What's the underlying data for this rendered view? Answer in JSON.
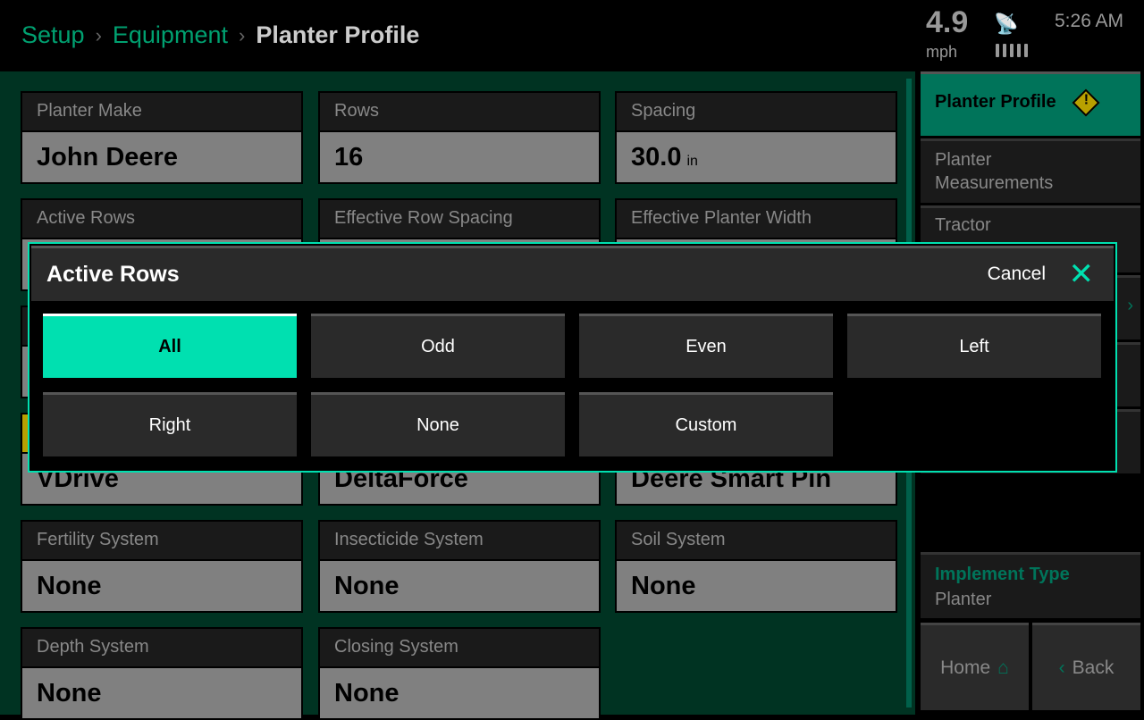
{
  "breadcrumb": [
    "Setup",
    "Equipment",
    "Planter Profile"
  ],
  "status": {
    "speed": "4.9",
    "speed_unit": "mph",
    "time": "5:26 AM",
    "gps_icon": "satellite-icon",
    "signal_bars": 5
  },
  "cards": [
    {
      "label": "Planter Make",
      "value": "John Deere"
    },
    {
      "label": "Rows",
      "value": "16"
    },
    {
      "label": "Spacing",
      "value": "30.0",
      "unit": "in"
    },
    {
      "label": "Active Rows",
      "value": ""
    },
    {
      "label": "Effective Row Spacing",
      "value": ""
    },
    {
      "label": "Effective Planter Width",
      "value": ""
    },
    {
      "label": "",
      "value": "VDrive"
    },
    {
      "label": "",
      "value": "DeltaForce"
    },
    {
      "label": "",
      "value": "Deere Smart Pin"
    },
    {
      "label": "Fertility System",
      "value": "None"
    },
    {
      "label": "Insecticide System",
      "value": "None"
    },
    {
      "label": "Soil System",
      "value": "None"
    },
    {
      "label": "Depth System",
      "value": "None"
    },
    {
      "label": "Closing System",
      "value": "None"
    }
  ],
  "sidebar": {
    "items": [
      "Planter Profile",
      "Planter Measurements",
      "Tractor"
    ],
    "implement_type_label": "Implement Type",
    "implement_type_value": "Planter",
    "home": "Home",
    "back": "Back"
  },
  "modal": {
    "title": "Active Rows",
    "cancel": "Cancel",
    "options": [
      "All",
      "Odd",
      "Even",
      "Left",
      "Right",
      "None",
      "Custom"
    ],
    "selected": "All"
  },
  "colors": {
    "accent": "#00e0b0",
    "brand_green": "#00745a",
    "background": "#003322",
    "warning": "#b8a000"
  }
}
